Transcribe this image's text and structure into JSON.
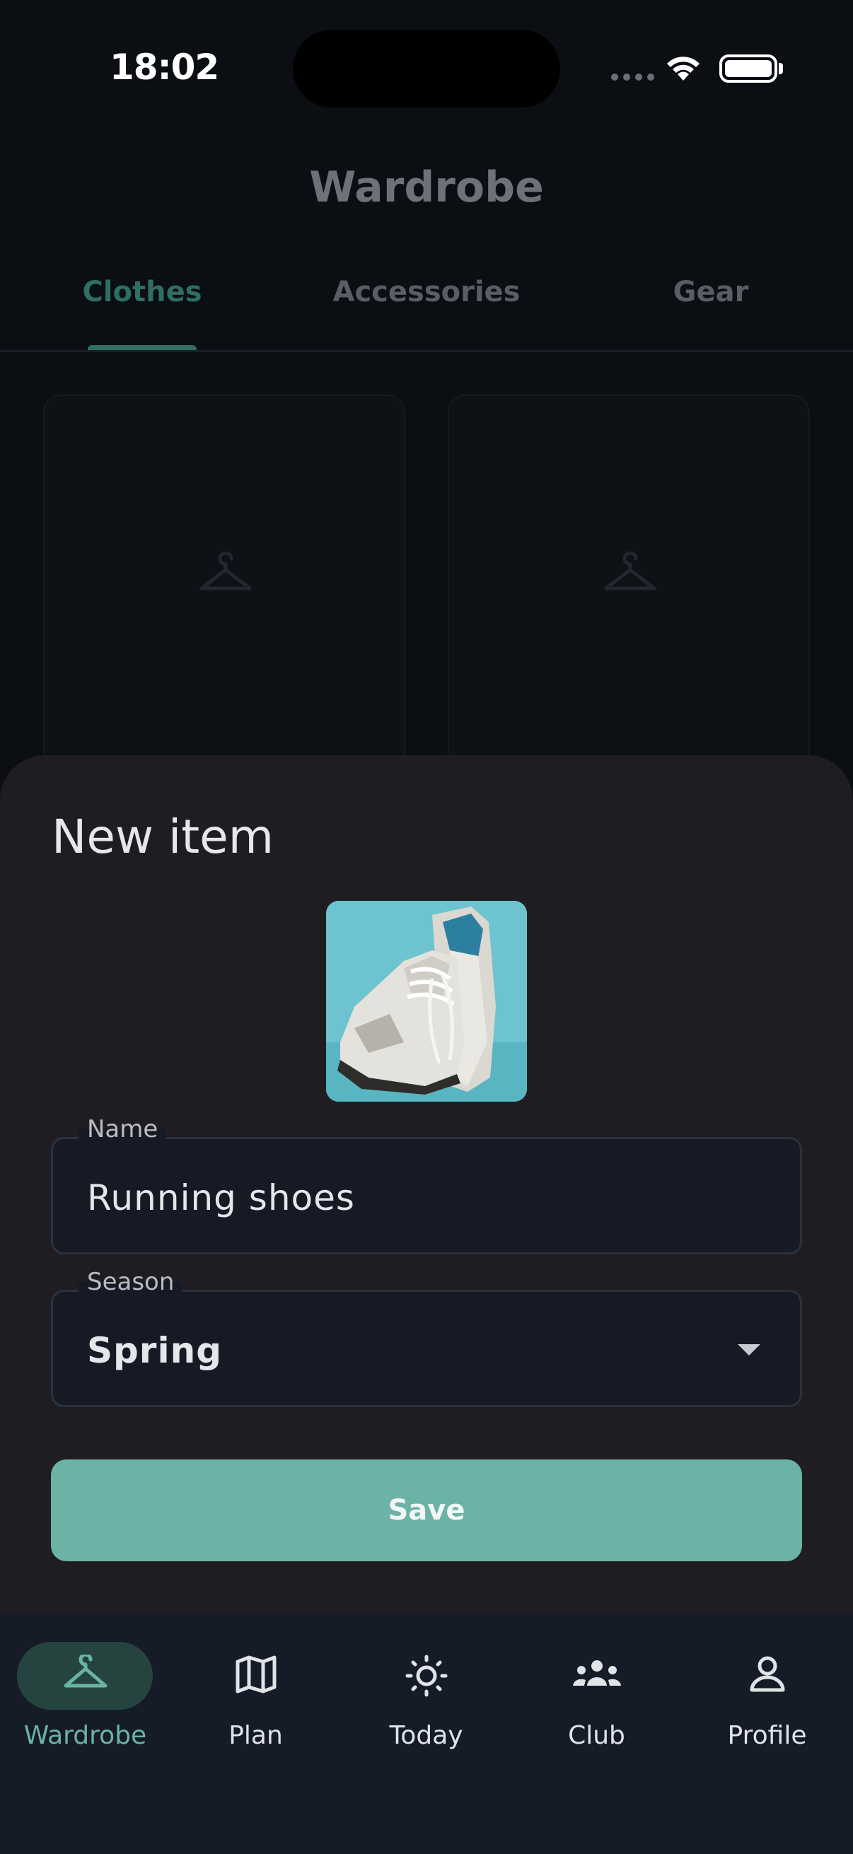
{
  "status_bar": {
    "time": "18:02"
  },
  "header": {
    "title": "Wardrobe",
    "tabs": [
      {
        "label": "Clothes",
        "active": true
      },
      {
        "label": "Accessories",
        "active": false
      },
      {
        "label": "Gear",
        "active": false
      }
    ]
  },
  "grid": {
    "placeholder_icon": "hanger-icon",
    "card_count_visible": 2
  },
  "sheet": {
    "title": "New item",
    "photo": {
      "subject": "running shoes photo"
    },
    "name_field": {
      "label": "Name",
      "value": "Running shoes"
    },
    "season_field": {
      "label": "Season",
      "value": "Spring"
    },
    "save_label": "Save"
  },
  "nav": {
    "items": [
      {
        "label": "Wardrobe",
        "icon": "hanger-icon",
        "active": true
      },
      {
        "label": "Plan",
        "icon": "map-icon",
        "active": false
      },
      {
        "label": "Today",
        "icon": "sun-icon",
        "active": false
      },
      {
        "label": "Club",
        "icon": "group-icon",
        "active": false
      },
      {
        "label": "Profile",
        "icon": "person-icon",
        "active": false
      }
    ]
  },
  "colors": {
    "accent": "#6bb3a7",
    "sheet_bg": "#1f1d21",
    "nav_bg": "#151b27",
    "field_bg": "#161a25"
  }
}
